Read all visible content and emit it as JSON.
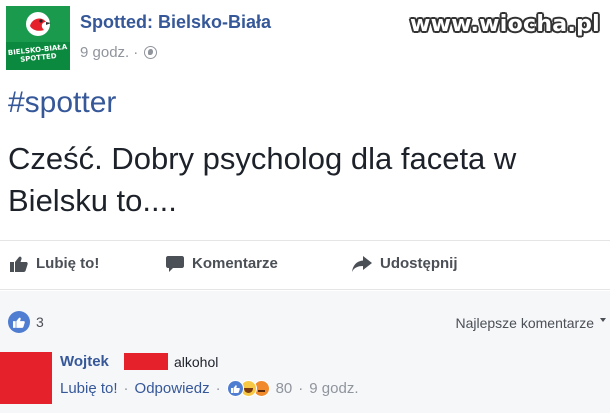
{
  "watermark": "www.wiocha.pl",
  "post": {
    "page_name": "Spotted: Bielsko-Biała",
    "time": "9 godz.",
    "separator": "·",
    "avatar_text": "BIELSKO-BIAŁA SPOTTED",
    "hashtag": "#spotter",
    "text_line1": "Cześć. Dobry psycholog dla faceta w",
    "text_line2": "Bielsku to...."
  },
  "actions": {
    "like": "Lubię to!",
    "comment": "Komentarze",
    "share": "Udostępnij"
  },
  "comments_section": {
    "reaction_count": "3",
    "sort_label": "Najlepsze komentarze",
    "comment": {
      "author": "Wojtek",
      "text": "alkohol",
      "like_label": "Lubię to!",
      "reply_label": "Odpowiedz",
      "reaction_count": "80",
      "time": "9 godz.",
      "separator": "·"
    }
  },
  "colors": {
    "link_blue": "#365899",
    "meta_grey": "#90949c",
    "censor_red": "#e5212b",
    "avatar_green": "#0b8a3f"
  }
}
